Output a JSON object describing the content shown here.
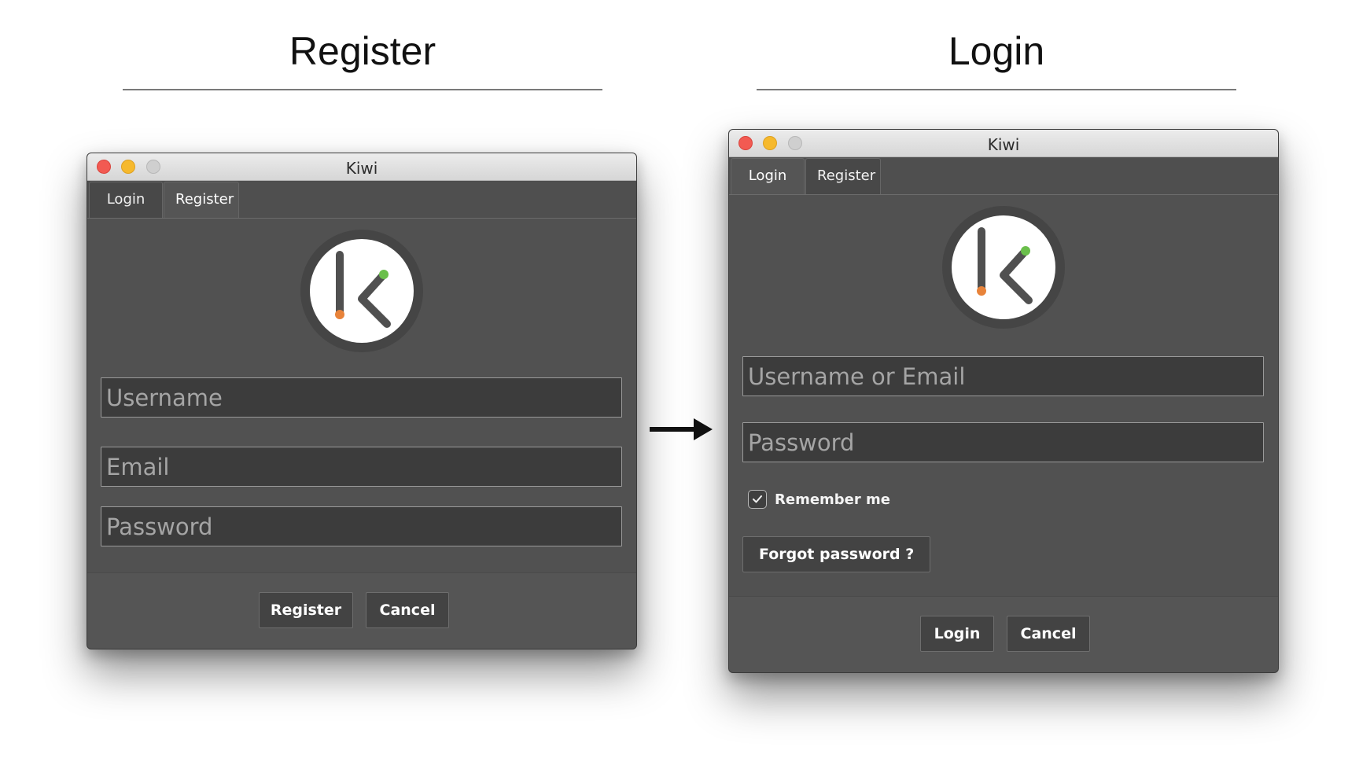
{
  "sections": {
    "register_heading": "Register",
    "login_heading": "Login"
  },
  "register_window": {
    "title": "Kiwi",
    "tabs": [
      "Login",
      "Register"
    ],
    "active_tab": "Register",
    "fields": {
      "username_placeholder": "Username",
      "email_placeholder": "Email",
      "password_placeholder": "Password"
    },
    "buttons": {
      "primary": "Register",
      "cancel": "Cancel"
    }
  },
  "login_window": {
    "title": "Kiwi",
    "tabs": [
      "Login",
      "Register"
    ],
    "active_tab": "Login",
    "fields": {
      "username_placeholder": "Username or Email",
      "password_placeholder": "Password"
    },
    "remember_me": {
      "label": "Remember me",
      "checked": true
    },
    "forgot_password": "Forgot password ?",
    "buttons": {
      "primary": "Login",
      "cancel": "Cancel"
    }
  },
  "colors": {
    "window_bg": "#515151",
    "field_bg": "#3c3c3c",
    "logo_dot_orange": "#e8833a",
    "logo_dot_green": "#6abf4b",
    "close": "#f25a52",
    "minimize": "#f6b92d",
    "zoom": "#cfcfcf"
  },
  "icons": {
    "logo": "kiwi-k-logo-icon",
    "flow_arrow": "right-arrow-icon",
    "check": "checkmark-icon"
  }
}
